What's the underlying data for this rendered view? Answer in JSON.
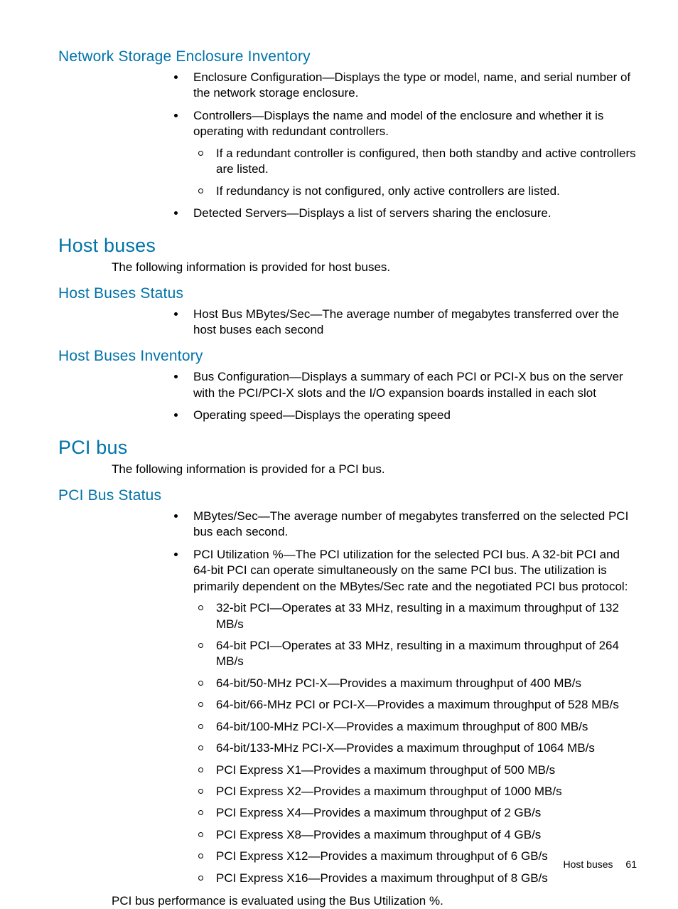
{
  "sections": {
    "nse_inventory": {
      "heading": "Network Storage Enclosure Inventory",
      "items": [
        {
          "text": "Enclosure Configuration—Displays the type or model, name, and serial number of the network storage enclosure."
        },
        {
          "text": "Controllers—Displays the name and model of the enclosure and whether it is operating with redundant controllers.",
          "sub": [
            "If a redundant controller is configured, then both standby and active controllers are listed.",
            "If redundancy is not configured, only active controllers are listed."
          ]
        },
        {
          "text": "Detected Servers—Displays a list of servers sharing the enclosure."
        }
      ]
    },
    "host_buses": {
      "heading": "Host buses",
      "intro": "The following information is provided for host buses."
    },
    "host_buses_status": {
      "heading": "Host Buses Status",
      "items": [
        {
          "text": "Host Bus MBytes/Sec—The average number of megabytes transferred over the host buses each second"
        }
      ]
    },
    "host_buses_inventory": {
      "heading": "Host Buses Inventory",
      "items": [
        {
          "text": "Bus Configuration—Displays a summary of each PCI or PCI-X bus on the server with the PCI/PCI-X slots and the I/O expansion boards installed in each slot"
        },
        {
          "text": "Operating speed—Displays the operating speed"
        }
      ]
    },
    "pci_bus": {
      "heading": "PCI bus",
      "intro": "The following information is provided for a PCI bus."
    },
    "pci_bus_status": {
      "heading": "PCI Bus Status",
      "items": [
        {
          "text": "MBytes/Sec—The average number of megabytes transferred on the selected PCI bus each second."
        },
        {
          "text": "PCI Utilization %—The PCI utilization for the selected PCI bus. A 32-bit PCI and 64-bit PCI can operate simultaneously on the same PCI bus. The utilization is primarily dependent on the MBytes/Sec rate and the negotiated PCI bus protocol:",
          "sub": [
            "32-bit PCI—Operates at 33 MHz, resulting in a maximum throughput of 132 MB/s",
            "64-bit PCI—Operates at 33 MHz, resulting in a maximum throughput of 264 MB/s",
            "64-bit/50-MHz PCI-X—Provides a maximum throughput of 400 MB/s",
            "64-bit/66-MHz PCI or PCI-X—Provides a maximum throughput of 528 MB/s",
            "64-bit/100-MHz PCI-X—Provides a maximum throughput of 800 MB/s",
            "64-bit/133-MHz PCI-X—Provides a maximum throughput of 1064 MB/s",
            "PCI Express X1—Provides a maximum throughput of 500 MB/s",
            "PCI Express X2—Provides a maximum throughput of 1000 MB/s",
            "PCI Express X4—Provides a maximum throughput of 2 GB/s",
            "PCI Express X8—Provides a maximum throughput of 4 GB/s",
            "PCI Express X12—Provides a maximum throughput of 6 GB/s",
            "PCI Express X16—Provides a maximum throughput of 8 GB/s"
          ]
        }
      ],
      "footnote": "PCI bus performance is evaluated using the Bus Utilization %."
    }
  },
  "footer": {
    "label": "Host buses",
    "page": "61"
  }
}
